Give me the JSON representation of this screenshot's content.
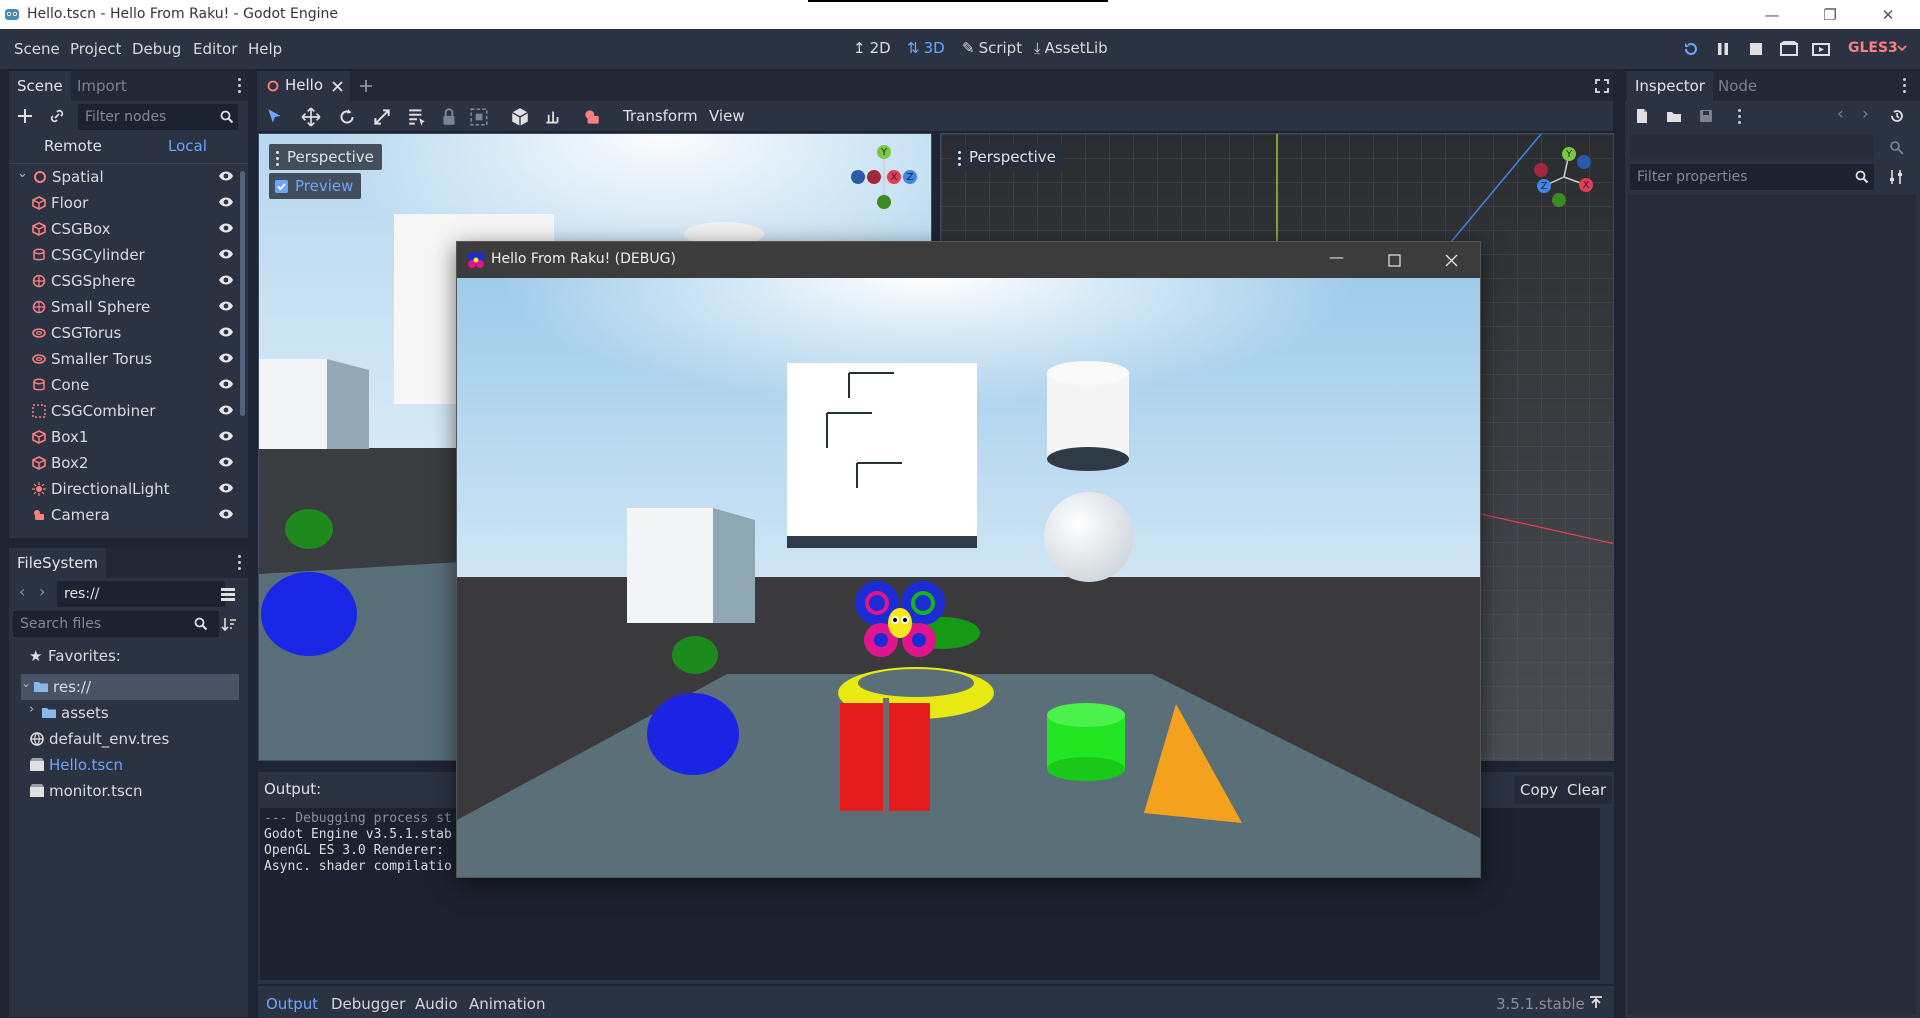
{
  "window": {
    "title": "Hello.tscn - Hello From Raku! - Godot Engine",
    "controls": {
      "minimize": "—",
      "restore": "❐",
      "close": "✕"
    }
  },
  "menu": {
    "items": [
      "Scene",
      "Project",
      "Debug",
      "Editor",
      "Help"
    ],
    "modes": [
      "2D",
      "3D",
      "Script",
      "AssetLib"
    ],
    "active_mode": "3D",
    "renderer": "GLES3"
  },
  "scene_dock": {
    "tabs": [
      "Scene",
      "Import"
    ],
    "filter_placeholder": "Filter nodes",
    "remote": "Remote",
    "local": "Local",
    "nodes": [
      {
        "name": "Spatial",
        "icon": "spatial-icon"
      },
      {
        "name": "Floor",
        "icon": "csg-box-icon"
      },
      {
        "name": "CSGBox",
        "icon": "csg-box-icon"
      },
      {
        "name": "CSGCylinder",
        "icon": "csg-cylinder-icon"
      },
      {
        "name": "CSGSphere",
        "icon": "csg-sphere-icon"
      },
      {
        "name": "Small Sphere",
        "icon": "csg-sphere-icon"
      },
      {
        "name": "CSGTorus",
        "icon": "csg-torus-icon"
      },
      {
        "name": "Smaller Torus",
        "icon": "csg-torus-icon"
      },
      {
        "name": "Cone",
        "icon": "csg-cylinder-icon"
      },
      {
        "name": "CSGCombiner",
        "icon": "csg-combiner-icon"
      },
      {
        "name": "Box1",
        "icon": "csg-box-icon"
      },
      {
        "name": "Box2",
        "icon": "csg-box-icon"
      },
      {
        "name": "DirectionalLight",
        "icon": "light-icon"
      },
      {
        "name": "Camera",
        "icon": "camera-icon"
      }
    ]
  },
  "filesystem": {
    "tab": "FileSystem",
    "path": "res://",
    "search_placeholder": "Search files",
    "favorites": "Favorites:",
    "items": [
      {
        "name": "res://",
        "icon": "folder-icon",
        "selected": true
      },
      {
        "name": "assets",
        "icon": "folder-icon"
      },
      {
        "name": "default_env.tres",
        "icon": "globe-icon"
      },
      {
        "name": "Hello.tscn",
        "icon": "scene-icon",
        "highlight": true
      },
      {
        "name": "monitor.tscn",
        "icon": "scene-icon"
      }
    ]
  },
  "editor_tabs": {
    "current": "Hello"
  },
  "toolbar": {
    "transform": "Transform",
    "view": "View"
  },
  "viewports": {
    "left_label": "Perspective",
    "preview_label": "Preview",
    "right_label": "Perspective",
    "gizmo_axes": [
      "Y",
      "X",
      "Z"
    ]
  },
  "game_window": {
    "title": "Hello From Raku! (DEBUG)"
  },
  "output": {
    "label": "Output:",
    "copy": "Copy",
    "clear": "Clear",
    "lines": [
      "--- Debugging process st",
      "Godot Engine v3.5.1.stab",
      "OpenGL ES 3.0 Renderer:",
      "Async. shader compilatio"
    ]
  },
  "bottom_tabs": [
    "Output",
    "Debugger",
    "Audio",
    "Animation"
  ],
  "active_bottom_tab": "Output",
  "version": "3.5.1.stable",
  "inspector": {
    "tabs": [
      "Inspector",
      "Node"
    ],
    "filter_placeholder": "Filter properties"
  },
  "colors": {
    "accent": "#6aa5ff",
    "panel": "#2b3242",
    "node_icon": "#fc7f7f"
  }
}
